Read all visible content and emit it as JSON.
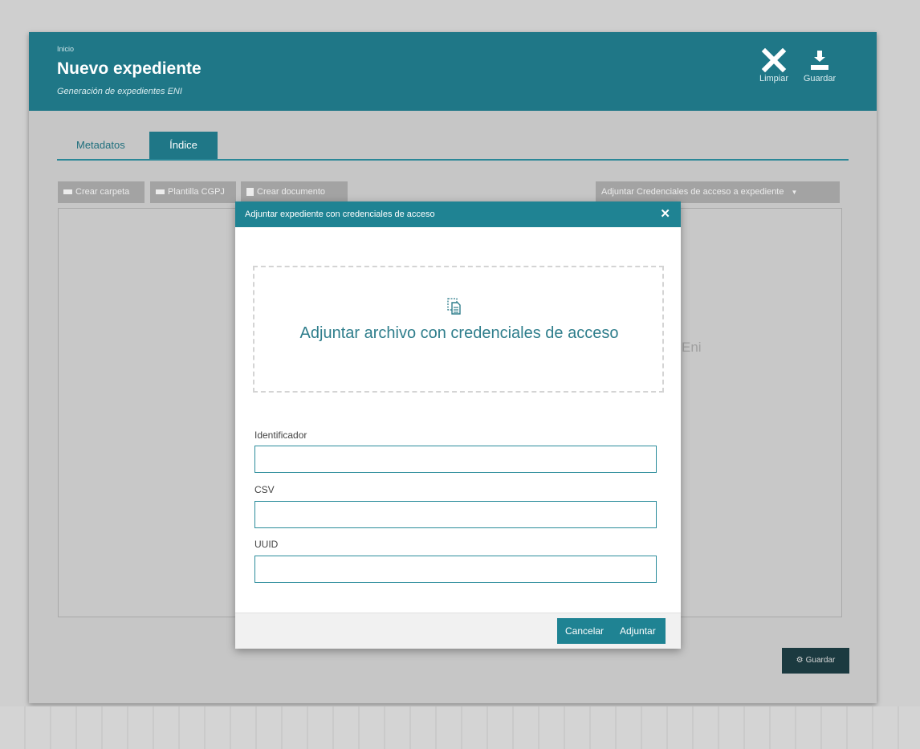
{
  "header": {
    "breadcrumb": "Inicio",
    "title": "Nuevo expediente",
    "subtitle": "Generación de expedientes ENI",
    "actions": {
      "limpiar_label": "Limpiar",
      "guardar_label": "Guardar"
    }
  },
  "tabs": [
    {
      "label": "Metadatos",
      "active": false
    },
    {
      "label": "Índice",
      "active": true
    }
  ],
  "toolbar": {
    "crear_carpeta": "Crear carpeta",
    "plantilla": "Plantilla CGPJ",
    "crear_documento": "Crear documento",
    "adjuntar_credenciales": "Adjuntar Credenciales de acceso a expediente"
  },
  "content": {
    "background_text": "Eni"
  },
  "bottom": {
    "save_label": "Guardar"
  },
  "modal": {
    "title": "Adjuntar expediente con credenciales de acceso",
    "dropzone_text": "Adjuntar archivo con credenciales de acceso",
    "fields": {
      "identificador_label": "Identificador",
      "identificador_value": "",
      "csv_label": "CSV",
      "csv_value": "",
      "uuid_label": "UUID",
      "uuid_value": ""
    },
    "cancel_label": "Cancelar",
    "submit_label": "Adjuntar"
  },
  "colors": {
    "header": "#1f7787",
    "accent": "#1f8393",
    "dark_button": "#1b3a40",
    "toolbar_button": "#a3a3a3"
  },
  "icons": {
    "limpiar": "close-icon",
    "guardar": "download-icon",
    "dropzone": "file-attach-icon",
    "modal_close": "close-icon",
    "bottom_save": "gear-icon"
  }
}
